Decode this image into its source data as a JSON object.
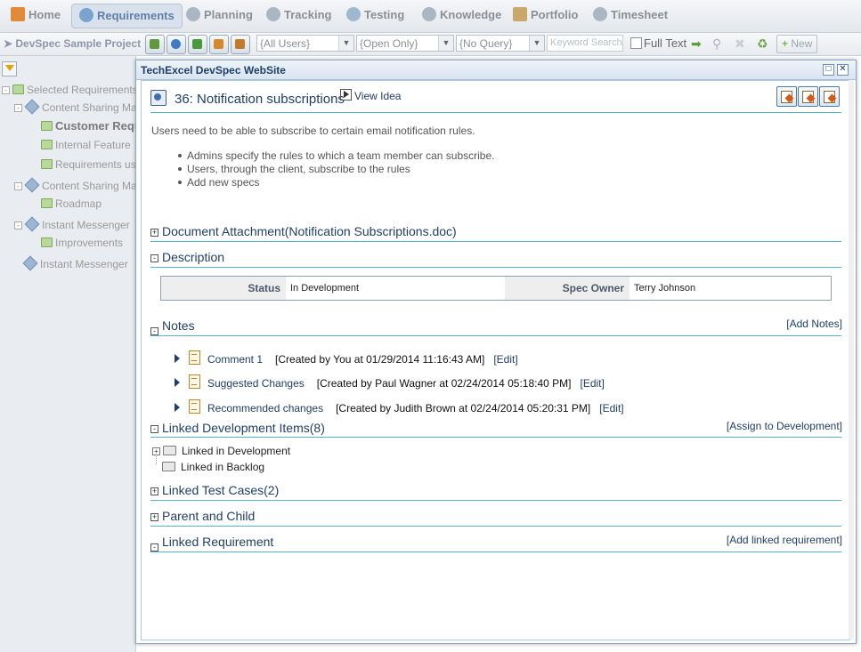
{
  "nav": {
    "tabs": [
      {
        "label": "Home",
        "icon": "home-icon"
      },
      {
        "label": "Requirements",
        "icon": "requirements-icon",
        "active": true
      },
      {
        "label": "Planning",
        "icon": "planning-icon"
      },
      {
        "label": "Tracking",
        "icon": "tracking-icon"
      },
      {
        "label": "Testing",
        "icon": "testing-icon"
      },
      {
        "label": "Knowledge",
        "icon": "knowledge-icon"
      },
      {
        "label": "Portfolio",
        "icon": "portfolio-icon"
      },
      {
        "label": "Timesheet",
        "icon": "timesheet-icon"
      }
    ]
  },
  "toolbar": {
    "project": "DevSpec Sample Project",
    "users_filter": "{All Users}",
    "status_filter": "{Open Only}",
    "query_filter": "{No Query}",
    "keyword_placeholder": "Keyword Search",
    "full_text_label": "Full Text",
    "new_label": "New"
  },
  "tree": {
    "items": [
      {
        "label": "Selected Requirements"
      },
      {
        "label": "Content Sharing Ma"
      },
      {
        "label": "Customer Requ"
      },
      {
        "label": "Internal Feature"
      },
      {
        "label": "Requirements us"
      },
      {
        "label": "Content Sharing Ma"
      },
      {
        "label": "Roadmap"
      },
      {
        "label": "Instant Messenger"
      },
      {
        "label": "Improvements"
      },
      {
        "label": "Instant Messenger"
      }
    ]
  },
  "modal": {
    "title": "TechExcel DevSpec WebSite",
    "spec_title": "36: Notification subscriptions",
    "view_idea": "View Idea",
    "description": "Users need to be able to subscribe to certain email notification rules.",
    "bullets": [
      "Admins specify the rules to which a team member can subscribe.",
      "Users, through the client, subscribe to the rules",
      "Add new specs"
    ],
    "sections": {
      "attachment": "Document Attachment(Notification Subscriptions.doc)",
      "description": "Description",
      "notes": "Notes",
      "add_notes": "[Add Notes]",
      "linked_dev": "Linked Development Items(8)",
      "assign_dev": "[Assign to Development]",
      "linked_test": "Linked Test Cases(2)",
      "parent_child": "Parent and Child",
      "linked_req": "Linked Requirement",
      "add_linked_req": "[Add linked requirement]"
    },
    "status": {
      "status_label": "Status",
      "status_value": "In Development",
      "owner_label": "Spec Owner",
      "owner_value": "Terry Johnson"
    },
    "notes": [
      {
        "title": "Comment 1",
        "meta": "[Created by You at 01/29/2014 11:16:43 AM]",
        "edit": "[Edit]"
      },
      {
        "title": "Suggested Changes",
        "meta": "[Created by Paul Wagner at 02/24/2014 05:18:40 PM]",
        "edit": "[Edit]"
      },
      {
        "title": "Recommended changes",
        "meta": "[Created by Judith Brown at 02/24/2014 05:20:31 PM]",
        "edit": "[Edit]"
      }
    ],
    "linked_dev_tree": [
      {
        "label": "Linked in Development"
      },
      {
        "label": "Linked in Backlog"
      }
    ]
  }
}
